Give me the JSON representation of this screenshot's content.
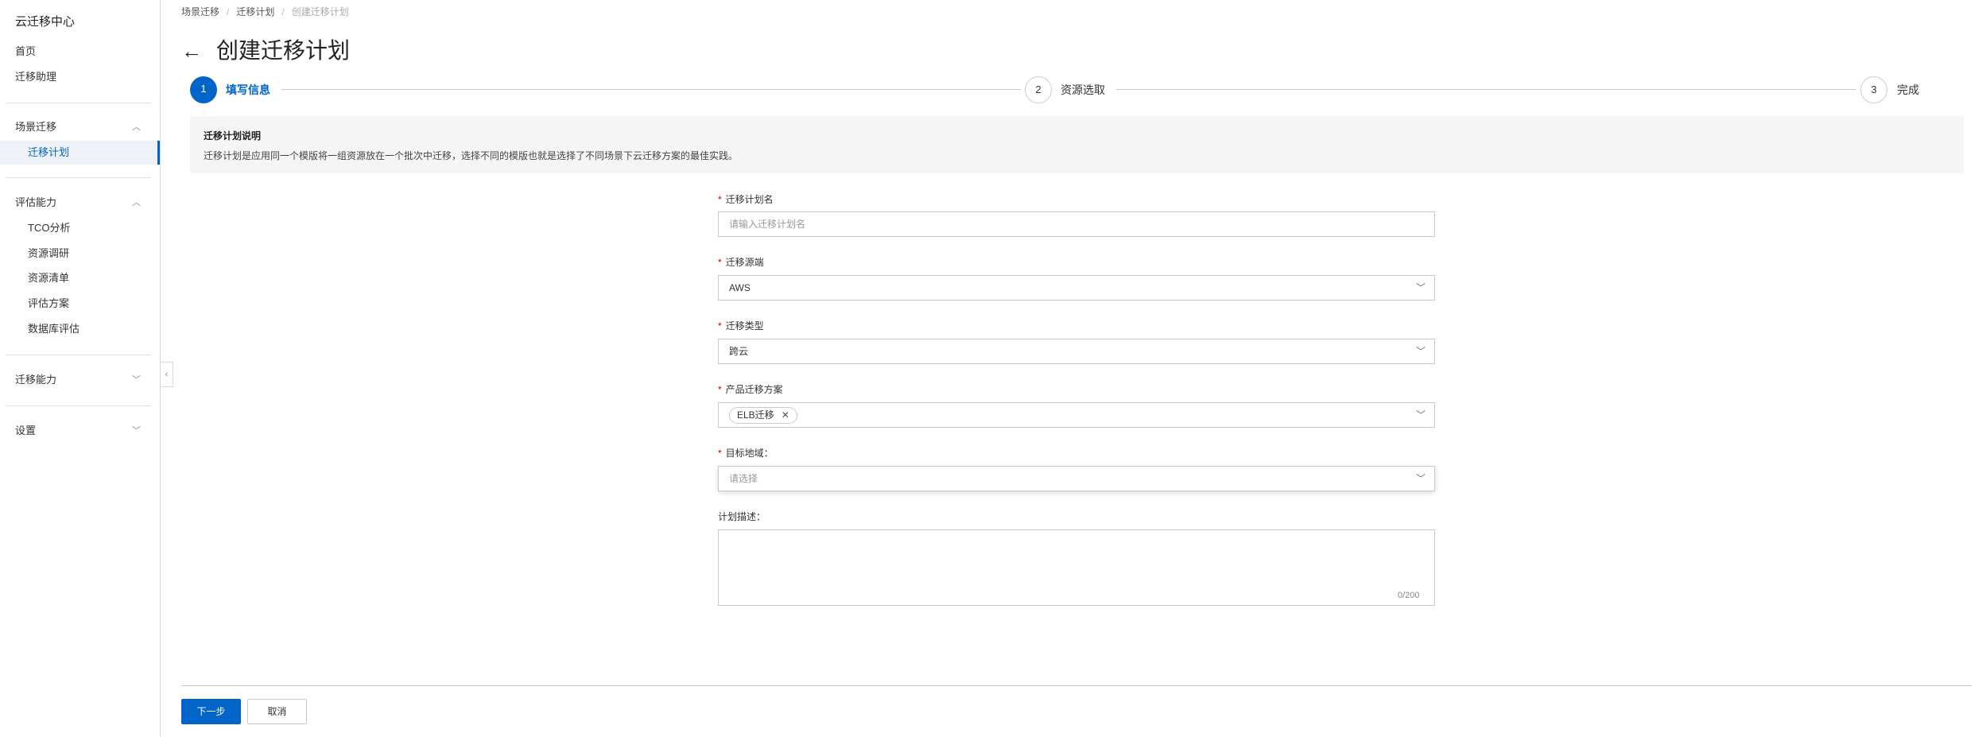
{
  "sidebar": {
    "title": "云迁移中心",
    "items": [
      {
        "label": "首页"
      },
      {
        "label": "迁移助理"
      },
      {
        "label": "场景迁移",
        "expanded": true
      },
      {
        "label": "迁移计划",
        "active": true
      },
      {
        "label": "评估能力",
        "expanded": true
      },
      {
        "label": "TCO分析"
      },
      {
        "label": "资源调研"
      },
      {
        "label": "资源清单"
      },
      {
        "label": "评估方案"
      },
      {
        "label": "数据库评估"
      },
      {
        "label": "迁移能力",
        "expanded": false
      },
      {
        "label": "设置",
        "expanded": false
      }
    ]
  },
  "breadcrumb": [
    "场景迁移",
    "迁移计划",
    "创建迁移计划"
  ],
  "page_title": "创建迁移计划",
  "steps": [
    {
      "num": "1",
      "label": "填写信息",
      "active": true
    },
    {
      "num": "2",
      "label": "资源选取"
    },
    {
      "num": "3",
      "label": "完成"
    }
  ],
  "description": {
    "title": "迁移计划说明",
    "text": "迁移计划是应用同一个模版将一组资源放在一个批次中迁移，选择不同的模版也就是选择了不同场景下云迁移方案的最佳实践。"
  },
  "form": {
    "plan_name": {
      "label": "迁移计划名",
      "placeholder": "请输入迁移计划名",
      "value": ""
    },
    "source": {
      "label": "迁移源端",
      "value": "AWS"
    },
    "type": {
      "label": "迁移类型",
      "value": "跨云"
    },
    "product": {
      "label": "产品迁移方案",
      "tags": [
        "ELB迁移"
      ]
    },
    "region": {
      "label": "目标地域：",
      "placeholder": "请选择"
    },
    "desc": {
      "label": "计划描述：",
      "value": "",
      "counter": "0/200"
    }
  },
  "buttons": {
    "next": "下一步",
    "cancel": "取消"
  },
  "colors": {
    "primary": "#0064c8",
    "required": "#d40000"
  }
}
